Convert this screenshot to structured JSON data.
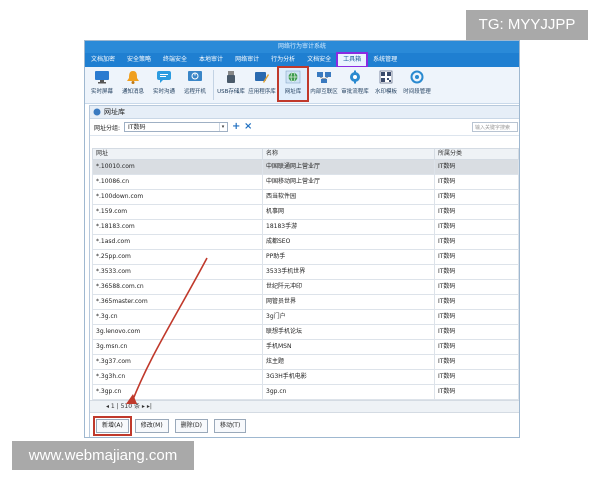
{
  "watermarks": {
    "top": "TG: MYYJJPP",
    "bottom": "www.webmajiang.com"
  },
  "app": {
    "title_strip": "网络行为审计系统",
    "menu": [
      "文档加密",
      "安全策略",
      "终端安全",
      "本地审计",
      "网络审计",
      "行为分析",
      "文档安全",
      "工具箱",
      "系统管理"
    ],
    "active_menu": "工具箱",
    "ribbon": [
      {
        "label": "实时屏幕",
        "icon": "monitor-icon",
        "color": "#2b7bd0"
      },
      {
        "label": "通知消息",
        "icon": "bell-icon",
        "color": "#f0a020"
      },
      {
        "label": "实时沟通",
        "icon": "chat-icon",
        "color": "#2b9be0"
      },
      {
        "label": "远程开机",
        "icon": "power-icon",
        "color": "#3a86c8"
      },
      {
        "label": "USB存储库",
        "icon": "usb-icon",
        "color": "#4a5a6a"
      },
      {
        "label": "应用程序库",
        "icon": "app-library-icon",
        "color": "#2a6ab0"
      },
      {
        "label": "网址库",
        "icon": "globe-icon",
        "color": "#3a9a4a"
      },
      {
        "label": "内部互联区",
        "icon": "network-icon",
        "color": "#3a7ac0"
      },
      {
        "label": "审批流程库",
        "icon": "gear-flow-icon",
        "color": "#2a8ad0"
      },
      {
        "label": "水印模板",
        "icon": "qrcode-icon",
        "color": "#3a4a6a"
      },
      {
        "label": "时间段管理",
        "icon": "clock-gear-icon",
        "color": "#2a8ad0"
      }
    ],
    "selected_ribbon": "网址库"
  },
  "window": {
    "title": "网址库",
    "filter_label": "网址分组:",
    "filter_value": "IT数码",
    "search_placeholder": "输入关键字搜索",
    "columns": [
      "网址",
      "名称",
      "所属分类"
    ],
    "rows": [
      [
        "*.10010.com",
        "中国联通网上营业厅",
        "IT数码"
      ],
      [
        "*.10086.cn",
        "中国移动网上营业厅",
        "IT数码"
      ],
      [
        "*.100down.com",
        "西当软件园",
        "IT数码"
      ],
      [
        "*.159.com",
        "机事网",
        "IT数码"
      ],
      [
        "*.18183.com",
        "18183手游",
        "IT数码"
      ],
      [
        "*.1asd.com",
        "成都SEO",
        "IT数码"
      ],
      [
        "*.25pp.com",
        "PP助手",
        "IT数码"
      ],
      [
        "*.3533.com",
        "3533手机世界",
        "IT数码"
      ],
      [
        "*.36588.com.cn",
        "世纪阡元冲印",
        "IT数码"
      ],
      [
        "*.365master.com",
        "网管员世界",
        "IT数码"
      ],
      [
        "*.3g.cn",
        "3g门户",
        "IT数码"
      ],
      [
        "3g.lenovo.com",
        "联想手机论坛",
        "IT数码"
      ],
      [
        "3g.msn.cn",
        "手机MSN",
        "IT数码"
      ],
      [
        "*.3g37.com",
        "炫主题",
        "IT数码"
      ],
      [
        "*.3g3h.cn",
        "3G3H手机电影",
        "IT数码"
      ],
      [
        "*.3gp.cn",
        "3gp.cn",
        "IT数码"
      ]
    ],
    "pager": {
      "page": "1",
      "total": "510 条"
    },
    "buttons": [
      "新增(A)",
      "修改(M)",
      "删除(D)",
      "移动(T)"
    ],
    "highlighted_button": "新增(A)"
  },
  "colors": {
    "accent": "#1f7fd1",
    "annotation_red": "#c0392b",
    "menu_highlight": "#8a2be2"
  }
}
